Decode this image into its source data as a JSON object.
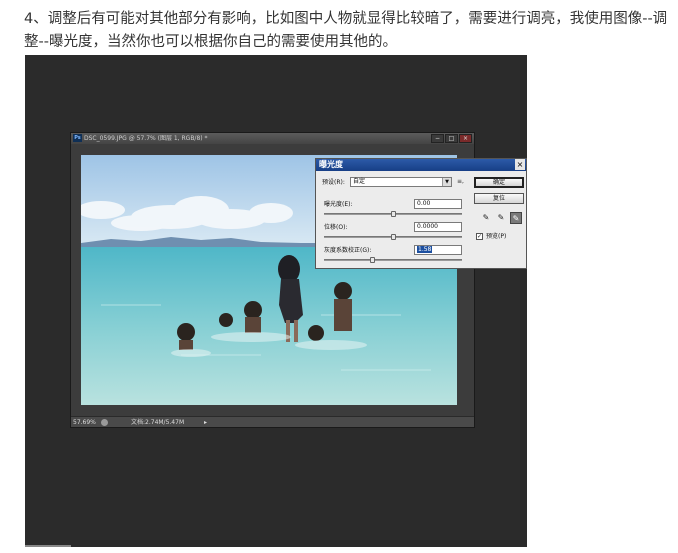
{
  "article": {
    "text": "4、调整后有可能对其他部分有影响，比如图中人物就显得比较暗了，需要进行调亮，我使用图像--调整--曝光度，当然你也可以根据你自己的需要使用其他的。"
  },
  "doc_window": {
    "app_badge": "Ps",
    "title": "DSC_0599.JPG @ 57.7% (图层 1, RGB/8) *",
    "minimize": "−",
    "maximize": "□",
    "close": "×",
    "status_zoom": "57.69%",
    "status_info": "文档:2.74M/5.47M",
    "status_arrow": "▸"
  },
  "exposure_dialog": {
    "title": "曝光度",
    "close": "×",
    "preset_label": "预设(R):",
    "preset_value": "自定",
    "preset_menu": "≡,",
    "exposure_label": "曝光度(E):",
    "exposure_value": "0.00",
    "exposure_slider": 0.5,
    "offset_label": "位移(O):",
    "offset_value": "0.0000",
    "offset_slider": 0.5,
    "gamma_label": "灰度系数校正(G):",
    "gamma_value": "1.58",
    "gamma_slider": 0.35,
    "ok_label": "确定",
    "reset_label": "复位",
    "preview_label": "预览(P)",
    "preview_checked": "✓"
  },
  "icons": {
    "eyedropper_black": "eyedropper-black-icon",
    "eyedropper_gray": "eyedropper-gray-icon",
    "eyedropper_white": "eyedropper-white-icon"
  },
  "colors": {
    "workspace": "#2b2b2b",
    "dialog_titlebar": "#1f4a96",
    "sea": "#7fc9cf",
    "sky": "#c8dff0"
  }
}
